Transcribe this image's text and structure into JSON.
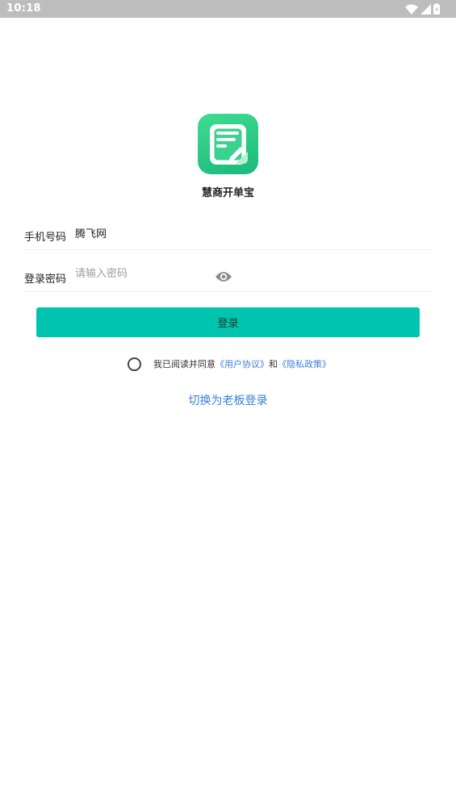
{
  "status_bar": {
    "time": "10:18",
    "icons": [
      "wifi-icon",
      "signal-icon",
      "battery-icon"
    ]
  },
  "app": {
    "name": "慧商开单宝",
    "logo_icon": "document-edit-icon",
    "logo_color": "#2fcf86"
  },
  "form": {
    "phone_label": "手机号码",
    "phone_value": "腾飞网",
    "password_label": "登录密码",
    "password_placeholder": "请输入密码",
    "password_toggle_icon": "eye-icon"
  },
  "login_button": {
    "label": "登录",
    "color": "#00c4ad"
  },
  "agreement": {
    "prefix": "我已阅读并同意",
    "user_agreement": "《用户协议》",
    "conjunction": "和",
    "privacy_policy": "《隐私政策》",
    "checked": false
  },
  "switch_login": {
    "label": "切换为老板登录",
    "color": "#3a7fdd"
  }
}
